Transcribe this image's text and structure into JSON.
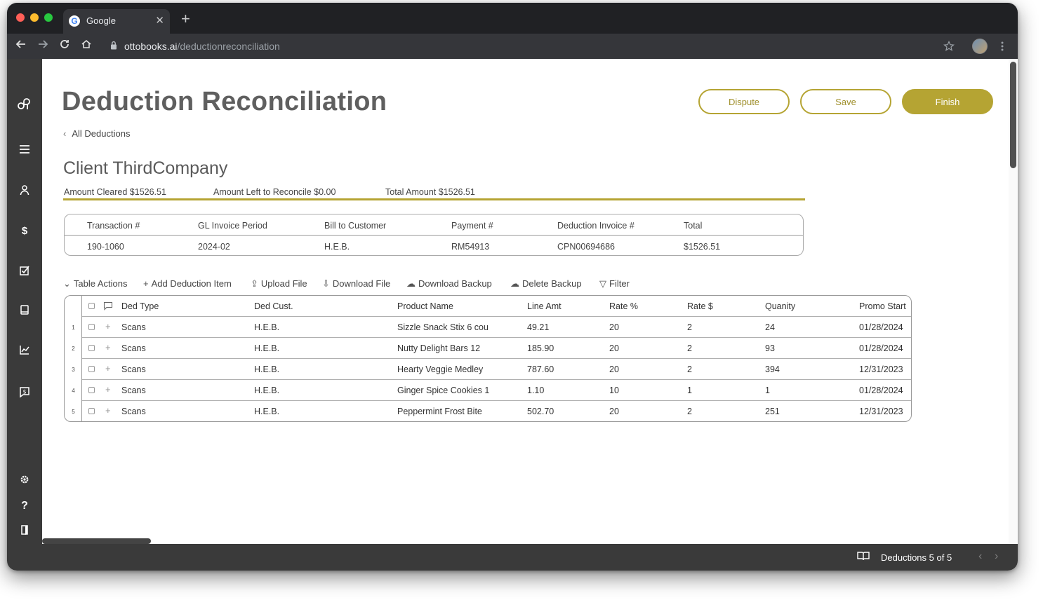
{
  "browser": {
    "tab_title": "Google",
    "tab_favicon": "G",
    "tab_close": "✕",
    "new_tab": "+",
    "url_host": "ottobooks.ai",
    "url_path": "/deductionreconciliation"
  },
  "page": {
    "title": "Deduction Reconciliation",
    "breadcrumb": "All Deductions",
    "client_title": "Client ThirdCompany"
  },
  "buttons": {
    "dispute": "Dispute",
    "save": "Save",
    "finish": "Finish"
  },
  "amounts": {
    "cleared": "Amount Cleared $1526.51",
    "left": "Amount Left to Reconcile $0.00",
    "total": "Total Amount $1526.51"
  },
  "info": {
    "headers": [
      "Transaction #",
      "GL Invoice Period",
      "Bill to Customer",
      "Payment #",
      "Deduction Invoice #",
      "Total"
    ],
    "values": [
      "190-1060",
      "2024-02",
      "H.E.B.",
      "RM54913",
      "CPN00694686",
      "$1526.51"
    ]
  },
  "table_actions": {
    "toggle": "Table Actions",
    "add": "Add Deduction Item",
    "upload": "Upload File",
    "download": "Download File",
    "download_backup": "Download Backup",
    "delete_backup": "Delete Backup",
    "filter": "Filter"
  },
  "grid": {
    "columns": [
      "Ded  Type",
      "Ded Cust.",
      "Product Name",
      "Line Amt",
      "Rate %",
      "Rate $",
      "Quanity",
      "Promo Start"
    ],
    "rows": [
      {
        "num": "1",
        "cells": [
          "Scans",
          "H.E.B.",
          "Sizzle Snack Stix 6 cou",
          "49.21",
          "20",
          "2",
          "24",
          "01/28/2024"
        ]
      },
      {
        "num": "2",
        "cells": [
          "Scans",
          "H.E.B.",
          "Nutty Delight Bars 12",
          "185.90",
          "20",
          "2",
          "93",
          "01/28/2024"
        ]
      },
      {
        "num": "3",
        "cells": [
          "Scans",
          "H.E.B.",
          "Hearty Veggie Medley",
          "787.60",
          "20",
          "2",
          "394",
          "12/31/2023"
        ]
      },
      {
        "num": "4",
        "cells": [
          "Scans",
          "H.E.B.",
          "Ginger Spice Cookies 1",
          "1.10",
          "10",
          "1",
          "1",
          "01/28/2024"
        ]
      },
      {
        "num": "5",
        "cells": [
          "Scans",
          "H.E.B.",
          "Peppermint Frost Bite",
          "502.70",
          "20",
          "2",
          "251",
          "12/31/2023"
        ]
      }
    ]
  },
  "footer": {
    "label": "Deductions 5 of 5"
  },
  "colors": {
    "accent": "#b5a433",
    "sidebar": "#3a3a3a"
  },
  "icons": {
    "sidebar": [
      "logo-icon",
      "menu-icon",
      "user-icon",
      "dollar-icon",
      "checkbox-icon",
      "book-icon",
      "chart-icon",
      "invoice-icon",
      "gear-icon",
      "help-icon",
      "door-icon"
    ]
  }
}
